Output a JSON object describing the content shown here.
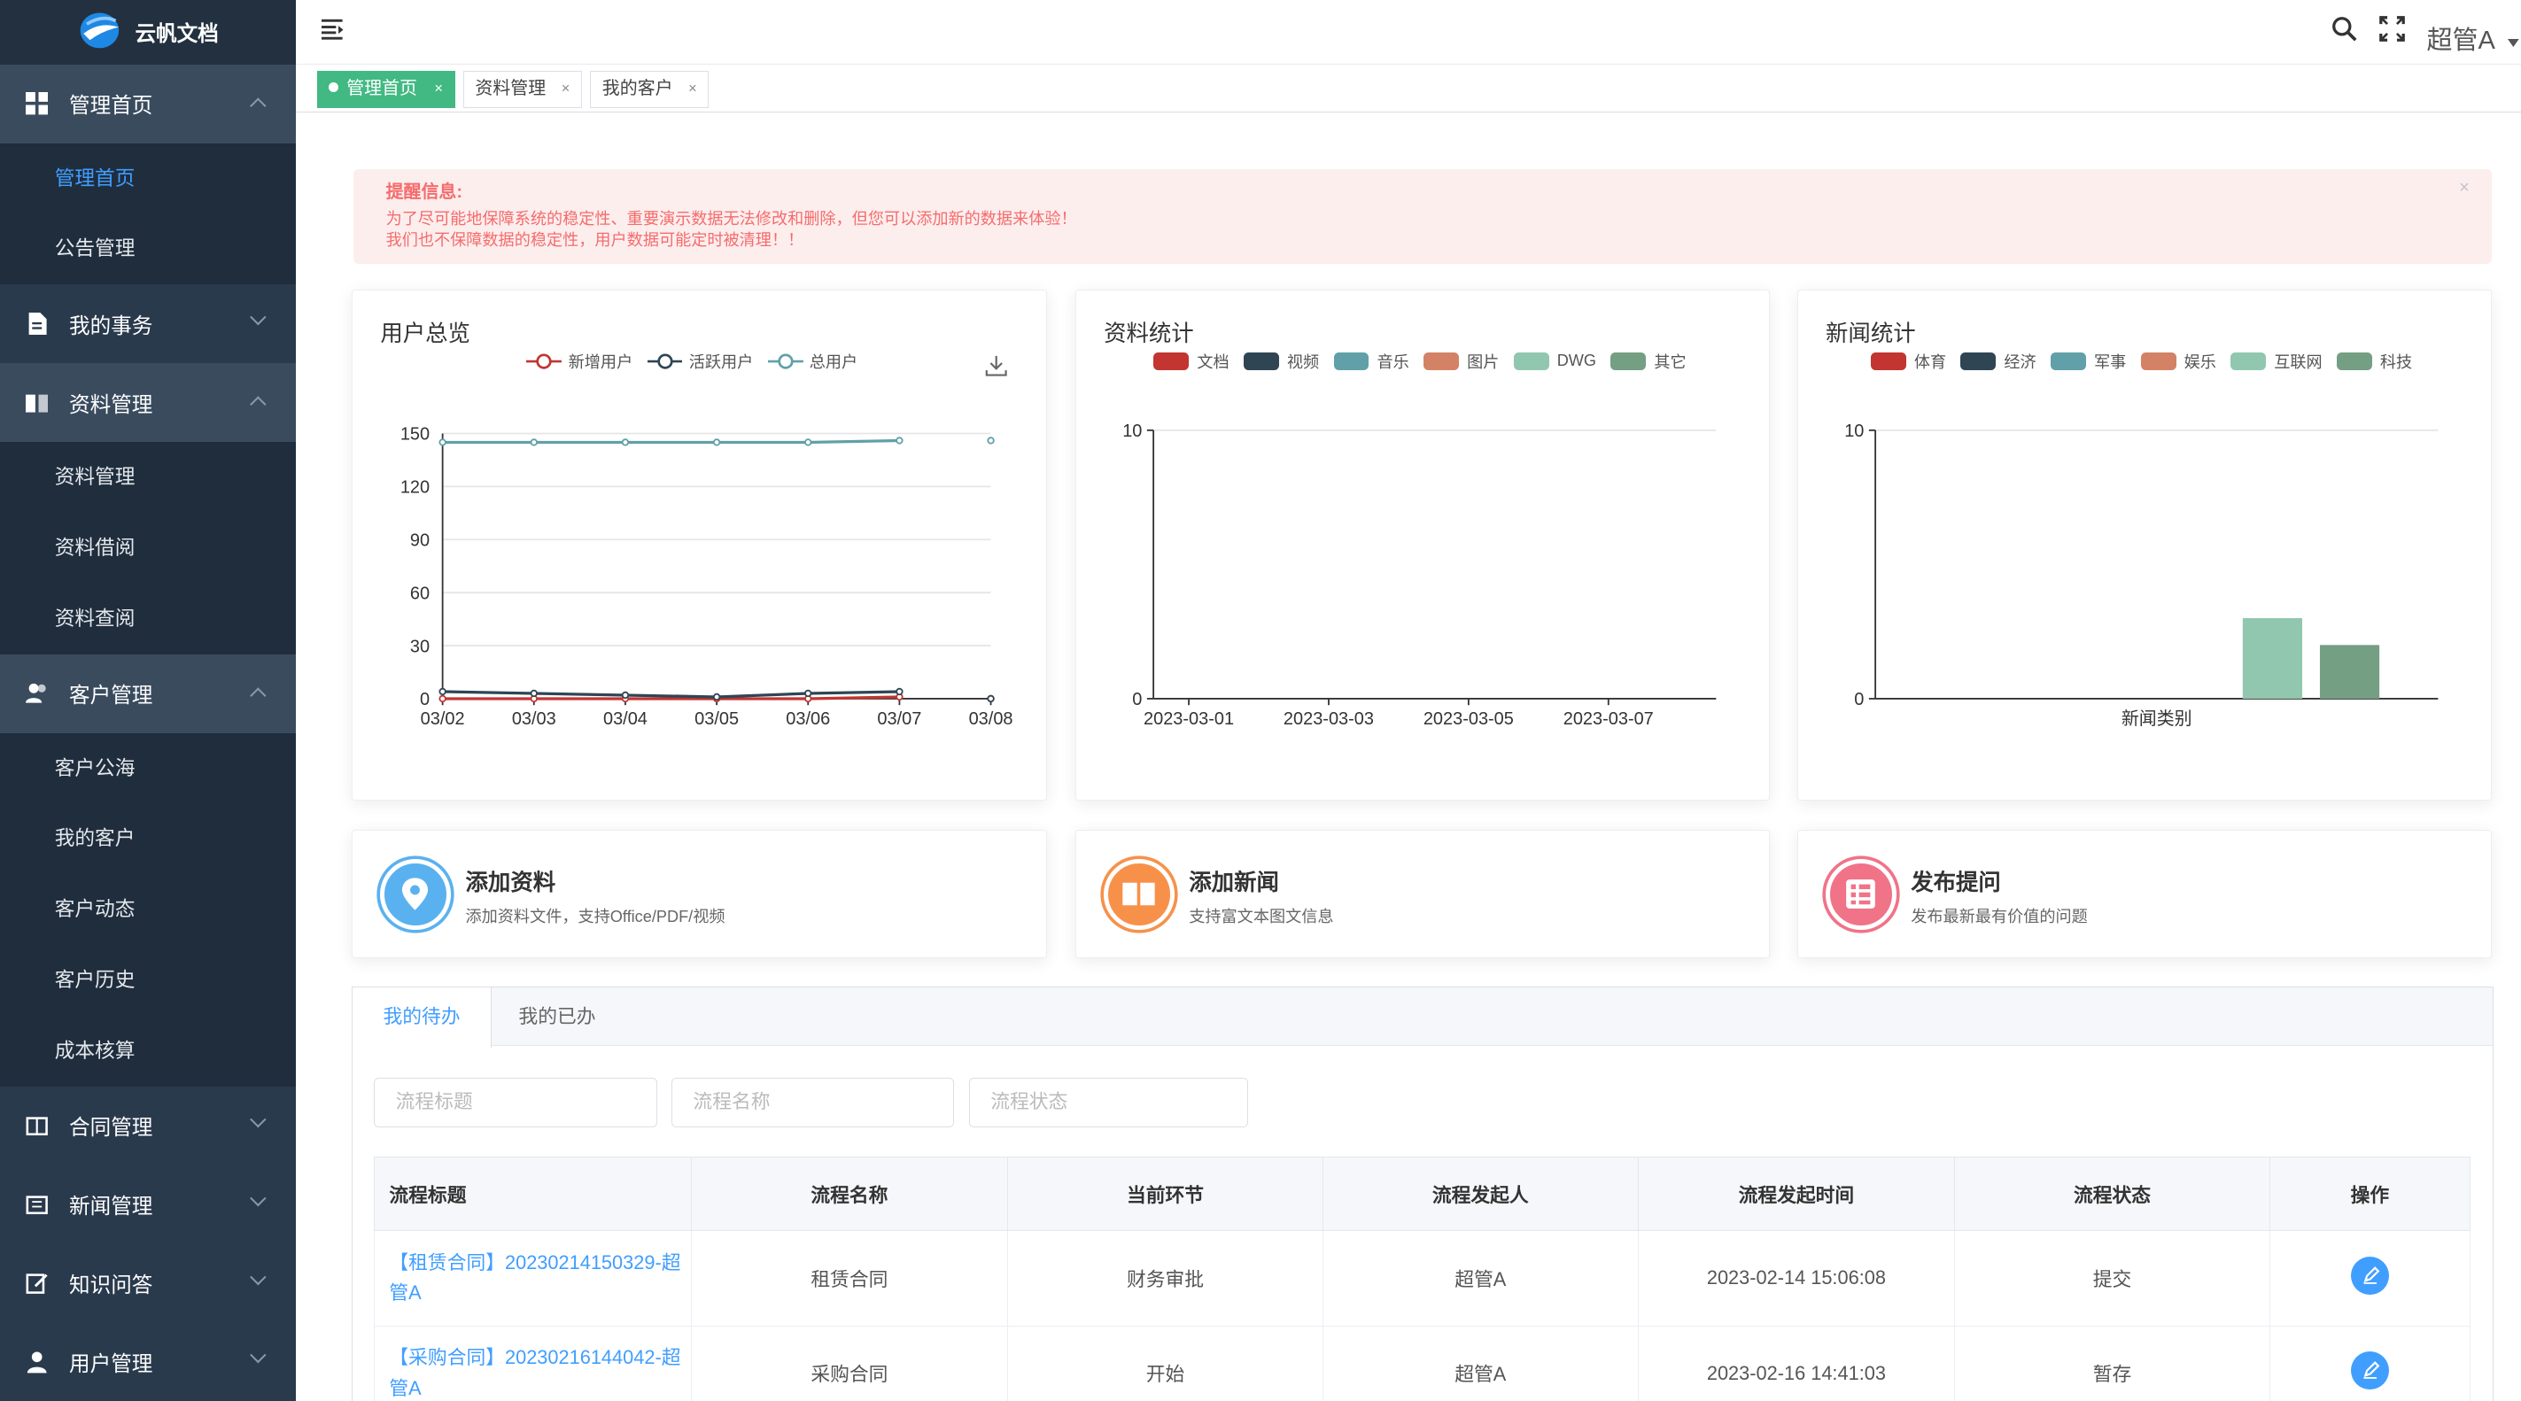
{
  "app": {
    "name": "云帆文档"
  },
  "sidebar": {
    "groups": [
      {
        "label": "管理首页",
        "icon": "grid-icon"
      },
      {
        "label": "我的事务",
        "icon": "document-icon"
      },
      {
        "label": "资料管理",
        "icon": "book-icon"
      },
      {
        "label": "客户管理",
        "icon": "users-icon"
      },
      {
        "label": "合同管理",
        "icon": "contract-icon"
      },
      {
        "label": "新闻管理",
        "icon": "news-icon"
      },
      {
        "label": "知识问答",
        "icon": "edit-icon"
      },
      {
        "label": "用户管理",
        "icon": "user-icon"
      }
    ],
    "home_items": [
      "管理首页",
      "公告管理"
    ],
    "doc_items": [
      "资料管理",
      "资料借阅",
      "资料查阅"
    ],
    "customer_items": [
      "客户公海",
      "我的客户",
      "客户动态",
      "客户历史",
      "成本核算"
    ]
  },
  "header": {
    "user": "超管A"
  },
  "tabs": [
    {
      "label": "管理首页",
      "active": true
    },
    {
      "label": "资料管理",
      "active": false
    },
    {
      "label": "我的客户",
      "active": false
    }
  ],
  "alert": {
    "title": "提醒信息:",
    "line1": "为了尽可能地保障系统的稳定性、重要演示数据无法修改和删除，但您可以添加新的数据来体验！",
    "line2": "我们也不保障数据的稳定性，用户数据可能定时被清理！！",
    "close": "×"
  },
  "chart_data": [
    {
      "type": "line",
      "title": "用户总览",
      "x": [
        "03/02",
        "03/03",
        "03/04",
        "03/05",
        "03/06",
        "03/07",
        "03/08"
      ],
      "ylim": [
        0,
        150
      ],
      "yticks": [
        0,
        30,
        60,
        90,
        120,
        150
      ],
      "series": [
        {
          "name": "新增用户",
          "color": "#c23531",
          "values": [
            0,
            0,
            0,
            0,
            0,
            1,
            0
          ]
        },
        {
          "name": "活跃用户",
          "color": "#2f4554",
          "values": [
            4,
            3,
            2,
            1,
            3,
            4,
            0
          ]
        },
        {
          "name": "总用户",
          "color": "#61a0a8",
          "values": [
            145,
            145,
            145,
            145,
            145,
            146,
            146
          ]
        }
      ]
    },
    {
      "type": "bar",
      "title": "资料统计",
      "x": [
        "2023-03-01",
        "2023-03-03",
        "2023-03-05",
        "2023-03-07"
      ],
      "ylim": [
        0,
        10
      ],
      "yticks": [
        0,
        10
      ],
      "series": [
        {
          "name": "文档",
          "color": "#c23531"
        },
        {
          "name": "视频",
          "color": "#2f4554"
        },
        {
          "name": "音乐",
          "color": "#61a0a8"
        },
        {
          "name": "图片",
          "color": "#d48265"
        },
        {
          "name": "DWG",
          "color": "#91c7ae"
        },
        {
          "name": "其它",
          "color": "#749f83"
        }
      ]
    },
    {
      "type": "bar",
      "title": "新闻统计",
      "categories": [
        "新闻类别"
      ],
      "ylim": [
        0,
        10
      ],
      "yticks": [
        0,
        10
      ],
      "series": [
        {
          "name": "体育",
          "color": "#c23531",
          "values": [
            0
          ]
        },
        {
          "name": "经济",
          "color": "#2f4554",
          "values": [
            0
          ]
        },
        {
          "name": "军事",
          "color": "#61a0a8",
          "values": [
            0
          ]
        },
        {
          "name": "娱乐",
          "color": "#d48265",
          "values": [
            0
          ]
        },
        {
          "name": "互联网",
          "color": "#91c7ae",
          "values": [
            3
          ]
        },
        {
          "name": "科技",
          "color": "#749f83",
          "values": [
            2
          ]
        }
      ]
    }
  ],
  "quick": [
    {
      "title": "添加资料",
      "desc": "添加资料文件，支持Office/PDF/视频",
      "color": "#5ab1ef",
      "icon": "pin-icon"
    },
    {
      "title": "添加新闻",
      "desc": "支持富文本图文信息",
      "color": "#f7914a",
      "icon": "book-open-icon"
    },
    {
      "title": "发布提问",
      "desc": "发布最新最有价值的问题",
      "color": "#f07388",
      "icon": "list-icon"
    }
  ],
  "todo": {
    "tabs": [
      "我的待办",
      "我的已办"
    ],
    "filters": [
      "流程标题",
      "流程名称",
      "流程状态"
    ],
    "columns": [
      "流程标题",
      "流程名称",
      "当前环节",
      "流程发起人",
      "流程发起时间",
      "流程状态",
      "操作"
    ],
    "rows": [
      {
        "title": "【租赁合同】20230214150329-超管A",
        "name": "租赁合同",
        "step": "财务审批",
        "starter": "超管A",
        "time": "2023-02-14 15:06:08",
        "status": "提交"
      },
      {
        "title": "【采购合同】20230216144042-超管A",
        "name": "采购合同",
        "step": "开始",
        "starter": "超管A",
        "time": "2023-02-16 14:41:03",
        "status": "暂存"
      }
    ]
  }
}
